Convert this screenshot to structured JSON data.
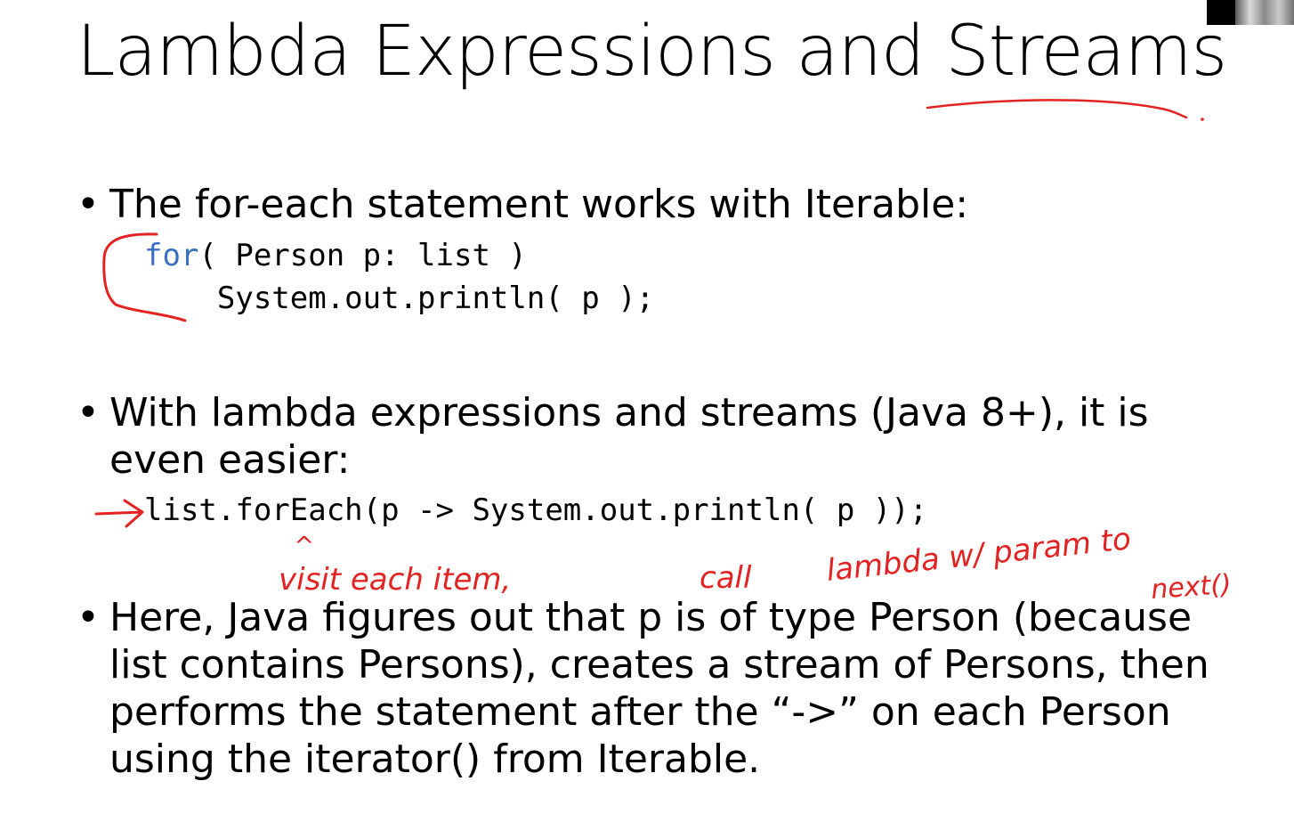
{
  "slide": {
    "title": "Lambda Expressions and Streams",
    "bullet_symbol": "•",
    "bullets": [
      {
        "lines": [
          "The for-each statement works with Iterable:"
        ]
      },
      {
        "lines": [
          "With lambda expressions and streams (Java 8+), it is",
          "even easier:"
        ]
      },
      {
        "lines": [
          "Here, Java figures out that p is of type Person (because",
          "list contains Persons), creates a stream of Persons, then",
          "performs the statement after the “->” on each Person",
          "using the iterator() from Iterable."
        ]
      }
    ],
    "code_foreach": {
      "keyword": "for",
      "line1_rest": "( Person p: list )",
      "line2": "    System.out.println( p );"
    },
    "code_lambda": "list.forEach(p -> System.out.println( p ));"
  },
  "annotations": {
    "ink_color": "#e32222",
    "caret": "^",
    "note1": "visit each item,",
    "note2": "call",
    "note3": "lambda w/ param to",
    "note4": "next()"
  },
  "webcam": {
    "icon": "webcam-thumbnail"
  }
}
